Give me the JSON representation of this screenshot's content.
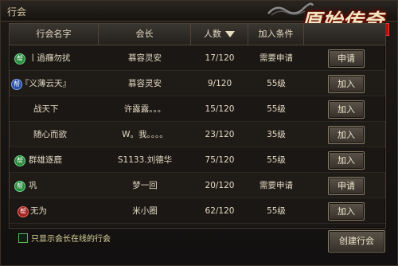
{
  "window": {
    "title": "行会"
  },
  "logo": {
    "text": "原始传奇"
  },
  "table": {
    "headers": [
      "行会名字",
      "会长",
      "人数",
      "加入条件"
    ],
    "rows": [
      {
        "name": "丨過癮勿扰",
        "icon": "green",
        "leader": "慕容灵安",
        "count": "17/120",
        "condition": "需要申请",
        "action": "申请"
      },
      {
        "name": "『义薄云天』",
        "icon": "blue",
        "leader": "慕容灵安",
        "count": "9/120",
        "condition": "55级",
        "action": "加入"
      },
      {
        "name": "战天下",
        "icon": "",
        "leader": "许露露。。。",
        "count": "15/120",
        "condition": "55级",
        "action": "加入"
      },
      {
        "name": "随心而欲",
        "icon": "",
        "leader": "W。我。。。。",
        "count": "23/120",
        "condition": "35级",
        "action": "加入"
      },
      {
        "name": "群雄逐鹿",
        "icon": "green",
        "leader": "S1133.刘德华",
        "count": "75/120",
        "condition": "55级",
        "action": "加入"
      },
      {
        "name": "巩",
        "icon": "green",
        "leader": "梦一回",
        "count": "20/120",
        "condition": "需要申请",
        "action": "申请"
      },
      {
        "name": "无为",
        "icon": "red",
        "leader": "米小圈",
        "count": "62/120",
        "condition": "55级",
        "action": "加入"
      }
    ]
  },
  "footer": {
    "checkbox_label": "只显示会长在线的行会",
    "create_button": "创建行会"
  },
  "colors": {
    "accent": "#e2d8c2",
    "panel": "#1a1714",
    "check": "#5fb85a"
  }
}
